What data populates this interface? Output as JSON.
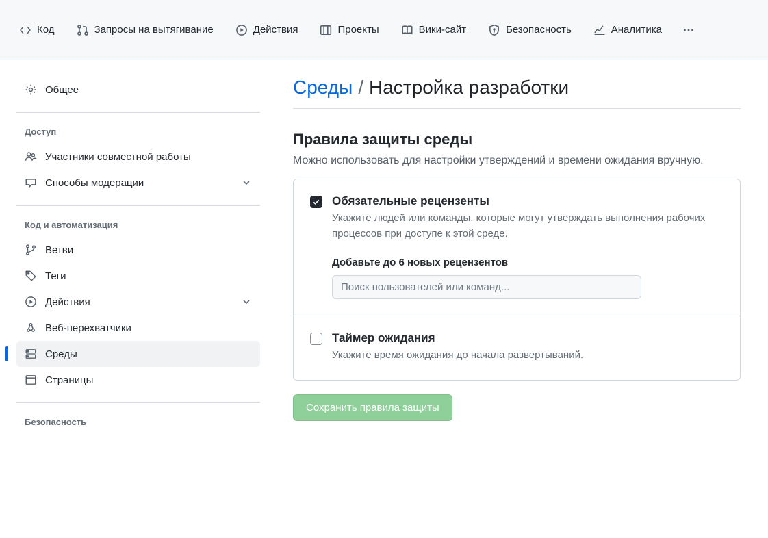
{
  "topnav": {
    "code": "Код",
    "pull_requests": "Запросы на вытягивание",
    "actions": "Действия",
    "projects": "Проекты",
    "wiki": "Вики-сайт",
    "security": "Безопасность",
    "insights": "Аналитика"
  },
  "sidebar": {
    "general": "Общее",
    "group_access": "Доступ",
    "collaborators": "Участники совместной работы",
    "moderation": "Способы модерации",
    "group_code": "Код и автоматизация",
    "branches": "Ветви",
    "tags": "Теги",
    "actions": "Действия",
    "webhooks": "Веб-перехватчики",
    "environments": "Среды",
    "pages": "Страницы",
    "group_security": "Безопасность"
  },
  "heading": {
    "crumb": "Среды",
    "sep": "/",
    "current": "Настройка разработки"
  },
  "protection": {
    "title": "Правила защиты среды",
    "desc": "Можно использовать для настройки утверждений и времени ожидания вручную.",
    "reviewers": {
      "title": "Обязательные рецензенты",
      "desc": "Укажите людей или команды, которые могут утверждать выполнения рабочих процессов при доступе к этой среде.",
      "add_label": "Добавьте до 6 новых рецензентов",
      "placeholder": "Поиск пользователей или команд..."
    },
    "wait": {
      "title": "Таймер ожидания",
      "desc": "Укажите время ожидания до начала развертываний."
    },
    "save": "Сохранить правила защиты"
  }
}
